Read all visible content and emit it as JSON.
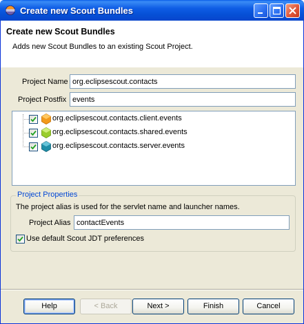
{
  "window": {
    "title": "Create new Scout Bundles"
  },
  "header": {
    "title": "Create new Scout Bundles",
    "description": "Adds new Scout Bundles to an existing Scout Project."
  },
  "form": {
    "project_name_label": "Project Name",
    "project_name_value": "org.eclipsescout.contacts",
    "project_postfix_label": "Project Postfix",
    "project_postfix_value": "events"
  },
  "bundles": [
    {
      "label": "org.eclipsescout.contacts.client.events",
      "checked": true,
      "color": "#f29a1c"
    },
    {
      "label": "org.eclipsescout.contacts.shared.events",
      "checked": true,
      "color": "#9acd2c"
    },
    {
      "label": "org.eclipsescout.contacts.server.events",
      "checked": true,
      "color": "#1f8ea8"
    }
  ],
  "project_properties": {
    "group_title": "Project Properties",
    "description": "The project alias is used for the servlet name and launcher names.",
    "alias_label": "Project Alias",
    "alias_value": "contactEvents",
    "jdt_checkbox_label": "Use default Scout JDT preferences",
    "jdt_checked": true
  },
  "buttons": {
    "help": "Help",
    "back": "< Back",
    "next": "Next >",
    "finish": "Finish",
    "cancel": "Cancel"
  },
  "colors": {
    "titlebar": "#0a5ee8",
    "group_title": "#0046d5",
    "dialog_bg": "#ece9d8"
  }
}
